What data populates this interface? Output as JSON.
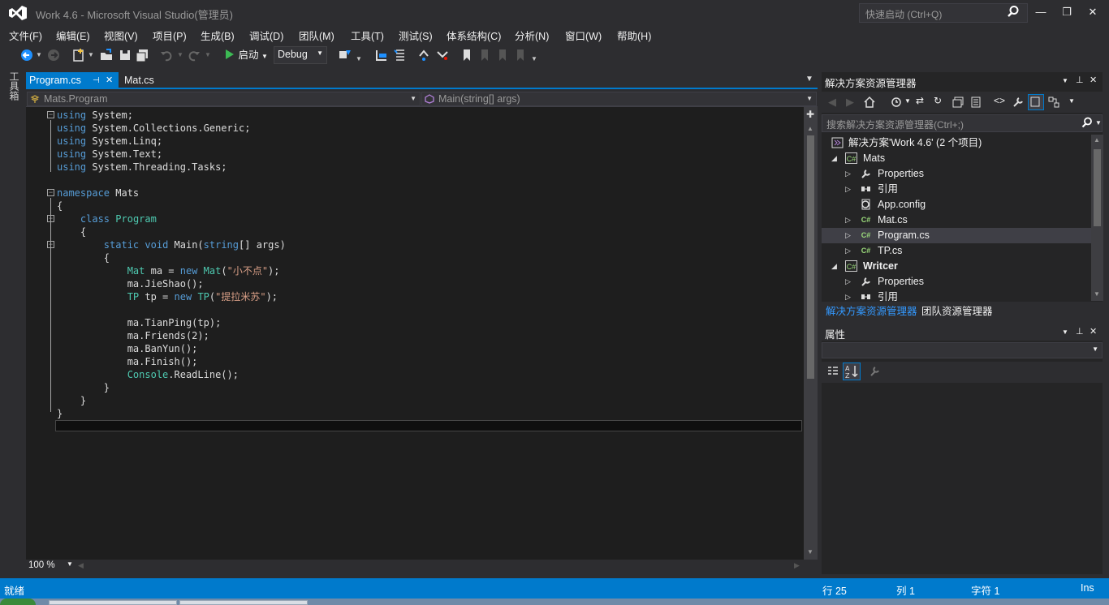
{
  "window": {
    "title": "Work 4.6 - Microsoft Visual Studio(管理员)",
    "quick_launch_placeholder": "快速启动 (Ctrl+Q)",
    "min": "—",
    "max": "❐",
    "close": "✕"
  },
  "menu": [
    {
      "label": "文件(F)"
    },
    {
      "label": "编辑(E)"
    },
    {
      "label": "视图(V)"
    },
    {
      "label": "项目(P)"
    },
    {
      "label": "生成(B)"
    },
    {
      "label": "调试(D)"
    },
    {
      "label": "团队(M)"
    },
    {
      "label": "工具(T)"
    },
    {
      "label": "测试(S)"
    },
    {
      "label": "体系结构(C)"
    },
    {
      "label": "分析(N)"
    },
    {
      "label": "窗口(W)"
    },
    {
      "label": "帮助(H)"
    }
  ],
  "toolbar": {
    "start_label": "启动",
    "configuration": "Debug"
  },
  "toolbox_tab": "工具箱",
  "editor": {
    "tabs": [
      {
        "label": "Program.cs",
        "pin": "⊣",
        "close": "✕"
      },
      {
        "label": "Mat.cs"
      }
    ],
    "nav_class": "Mats.Program",
    "nav_member": "Main(string[] args)",
    "zoom": "100 %"
  },
  "solution_explorer": {
    "title": "解决方案资源管理器",
    "search_placeholder": "搜索解决方案资源管理器(Ctrl+;)",
    "tree": [
      {
        "label": "解决方案'Work 4.6' (2 个项目)",
        "icon": "solution-icon",
        "bold": false
      },
      {
        "label": "Mats",
        "icon": "csharp-project-icon",
        "bold": false
      },
      {
        "label": "Properties",
        "icon": "wrench-icon",
        "bold": false
      },
      {
        "label": "引用",
        "icon": "references-icon",
        "bold": false
      },
      {
        "label": "App.config",
        "icon": "config-file-icon",
        "bold": false
      },
      {
        "label": "Mat.cs",
        "icon": "csharp-file-icon",
        "bold": false
      },
      {
        "label": "Program.cs",
        "icon": "csharp-file-icon",
        "bold": false,
        "selected": true
      },
      {
        "label": "TP.cs",
        "icon": "csharp-file-icon",
        "bold": false
      },
      {
        "label": "Writcer",
        "icon": "csharp-project-icon",
        "bold": true
      },
      {
        "label": "Properties",
        "icon": "wrench-icon",
        "bold": false
      },
      {
        "label": "引用",
        "icon": "references-icon",
        "bold": false
      }
    ],
    "tab_solution": "解决方案资源管理器",
    "tab_team": "团队资源管理器"
  },
  "properties": {
    "title": "属性"
  },
  "status": {
    "ready": "就绪",
    "line": "行 25",
    "col": "列 1",
    "char": "字符 1",
    "mode": "Ins"
  },
  "colors": {
    "accent": "#007acc",
    "keyword": "#569cd6",
    "type": "#4ec9b0",
    "string": "#d69d85"
  }
}
